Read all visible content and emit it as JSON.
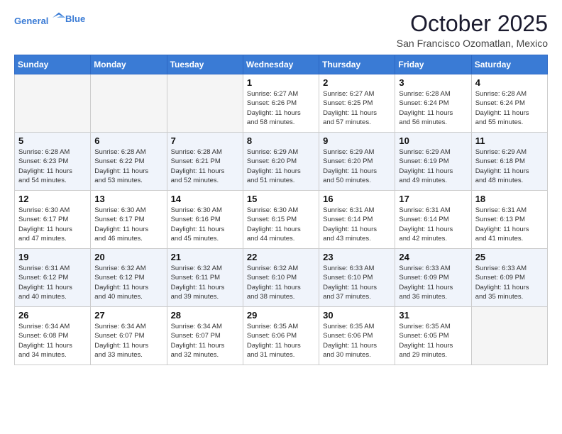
{
  "header": {
    "logo_line1": "General",
    "logo_line2": "Blue",
    "month": "October 2025",
    "location": "San Francisco Ozomatlan, Mexico"
  },
  "weekdays": [
    "Sunday",
    "Monday",
    "Tuesday",
    "Wednesday",
    "Thursday",
    "Friday",
    "Saturday"
  ],
  "weeks": [
    [
      {
        "day": "",
        "info": ""
      },
      {
        "day": "",
        "info": ""
      },
      {
        "day": "",
        "info": ""
      },
      {
        "day": "1",
        "info": "Sunrise: 6:27 AM\nSunset: 6:26 PM\nDaylight: 11 hours\nand 58 minutes."
      },
      {
        "day": "2",
        "info": "Sunrise: 6:27 AM\nSunset: 6:25 PM\nDaylight: 11 hours\nand 57 minutes."
      },
      {
        "day": "3",
        "info": "Sunrise: 6:28 AM\nSunset: 6:24 PM\nDaylight: 11 hours\nand 56 minutes."
      },
      {
        "day": "4",
        "info": "Sunrise: 6:28 AM\nSunset: 6:24 PM\nDaylight: 11 hours\nand 55 minutes."
      }
    ],
    [
      {
        "day": "5",
        "info": "Sunrise: 6:28 AM\nSunset: 6:23 PM\nDaylight: 11 hours\nand 54 minutes."
      },
      {
        "day": "6",
        "info": "Sunrise: 6:28 AM\nSunset: 6:22 PM\nDaylight: 11 hours\nand 53 minutes."
      },
      {
        "day": "7",
        "info": "Sunrise: 6:28 AM\nSunset: 6:21 PM\nDaylight: 11 hours\nand 52 minutes."
      },
      {
        "day": "8",
        "info": "Sunrise: 6:29 AM\nSunset: 6:20 PM\nDaylight: 11 hours\nand 51 minutes."
      },
      {
        "day": "9",
        "info": "Sunrise: 6:29 AM\nSunset: 6:20 PM\nDaylight: 11 hours\nand 50 minutes."
      },
      {
        "day": "10",
        "info": "Sunrise: 6:29 AM\nSunset: 6:19 PM\nDaylight: 11 hours\nand 49 minutes."
      },
      {
        "day": "11",
        "info": "Sunrise: 6:29 AM\nSunset: 6:18 PM\nDaylight: 11 hours\nand 48 minutes."
      }
    ],
    [
      {
        "day": "12",
        "info": "Sunrise: 6:30 AM\nSunset: 6:17 PM\nDaylight: 11 hours\nand 47 minutes."
      },
      {
        "day": "13",
        "info": "Sunrise: 6:30 AM\nSunset: 6:17 PM\nDaylight: 11 hours\nand 46 minutes."
      },
      {
        "day": "14",
        "info": "Sunrise: 6:30 AM\nSunset: 6:16 PM\nDaylight: 11 hours\nand 45 minutes."
      },
      {
        "day": "15",
        "info": "Sunrise: 6:30 AM\nSunset: 6:15 PM\nDaylight: 11 hours\nand 44 minutes."
      },
      {
        "day": "16",
        "info": "Sunrise: 6:31 AM\nSunset: 6:14 PM\nDaylight: 11 hours\nand 43 minutes."
      },
      {
        "day": "17",
        "info": "Sunrise: 6:31 AM\nSunset: 6:14 PM\nDaylight: 11 hours\nand 42 minutes."
      },
      {
        "day": "18",
        "info": "Sunrise: 6:31 AM\nSunset: 6:13 PM\nDaylight: 11 hours\nand 41 minutes."
      }
    ],
    [
      {
        "day": "19",
        "info": "Sunrise: 6:31 AM\nSunset: 6:12 PM\nDaylight: 11 hours\nand 40 minutes."
      },
      {
        "day": "20",
        "info": "Sunrise: 6:32 AM\nSunset: 6:12 PM\nDaylight: 11 hours\nand 40 minutes."
      },
      {
        "day": "21",
        "info": "Sunrise: 6:32 AM\nSunset: 6:11 PM\nDaylight: 11 hours\nand 39 minutes."
      },
      {
        "day": "22",
        "info": "Sunrise: 6:32 AM\nSunset: 6:10 PM\nDaylight: 11 hours\nand 38 minutes."
      },
      {
        "day": "23",
        "info": "Sunrise: 6:33 AM\nSunset: 6:10 PM\nDaylight: 11 hours\nand 37 minutes."
      },
      {
        "day": "24",
        "info": "Sunrise: 6:33 AM\nSunset: 6:09 PM\nDaylight: 11 hours\nand 36 minutes."
      },
      {
        "day": "25",
        "info": "Sunrise: 6:33 AM\nSunset: 6:09 PM\nDaylight: 11 hours\nand 35 minutes."
      }
    ],
    [
      {
        "day": "26",
        "info": "Sunrise: 6:34 AM\nSunset: 6:08 PM\nDaylight: 11 hours\nand 34 minutes."
      },
      {
        "day": "27",
        "info": "Sunrise: 6:34 AM\nSunset: 6:07 PM\nDaylight: 11 hours\nand 33 minutes."
      },
      {
        "day": "28",
        "info": "Sunrise: 6:34 AM\nSunset: 6:07 PM\nDaylight: 11 hours\nand 32 minutes."
      },
      {
        "day": "29",
        "info": "Sunrise: 6:35 AM\nSunset: 6:06 PM\nDaylight: 11 hours\nand 31 minutes."
      },
      {
        "day": "30",
        "info": "Sunrise: 6:35 AM\nSunset: 6:06 PM\nDaylight: 11 hours\nand 30 minutes."
      },
      {
        "day": "31",
        "info": "Sunrise: 6:35 AM\nSunset: 6:05 PM\nDaylight: 11 hours\nand 29 minutes."
      },
      {
        "day": "",
        "info": ""
      }
    ]
  ]
}
